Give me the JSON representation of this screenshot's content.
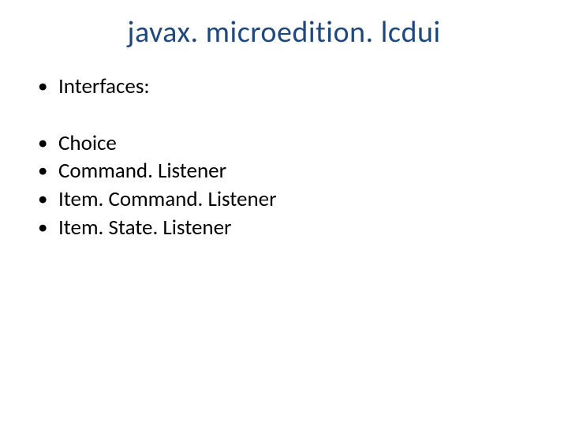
{
  "title": "javax. microedition. lcdui",
  "section_label": "Interfaces:",
  "items": [
    "Choice",
    "Command. Listener",
    "Item. Command. Listener",
    "Item. State. Listener"
  ]
}
